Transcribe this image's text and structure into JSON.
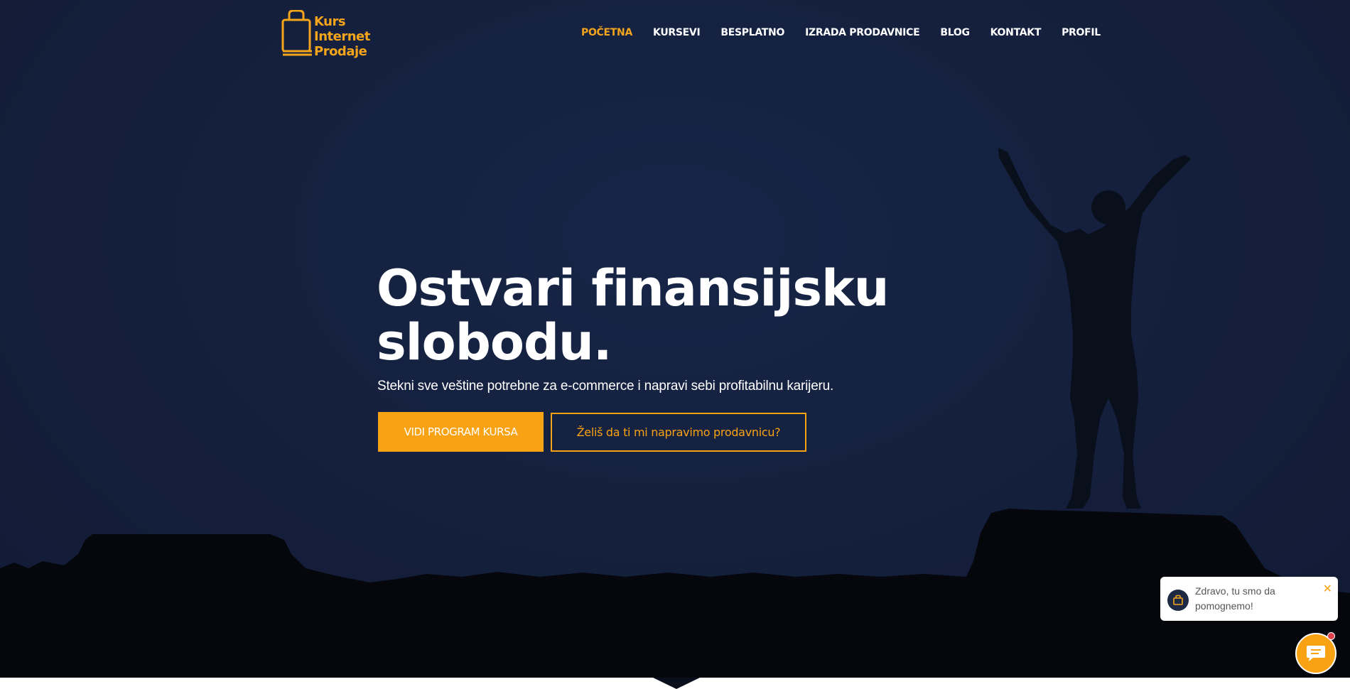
{
  "brand": {
    "logo_lines": [
      "Kurs",
      "Internet",
      "Prodaje"
    ],
    "accent_color": "#f9a314",
    "background_color": "#141f3c"
  },
  "nav": {
    "items": [
      {
        "label": "POČETNA",
        "active": true
      },
      {
        "label": "KURSEVI",
        "active": false
      },
      {
        "label": "BESPLATNO",
        "active": false
      },
      {
        "label": "IZRADA PRODAVNICE",
        "active": false
      },
      {
        "label": "BLOG",
        "active": false
      },
      {
        "label": "KONTAKT",
        "active": false
      },
      {
        "label": "PROFIL",
        "active": false
      }
    ]
  },
  "hero": {
    "headline_line1": "Ostvari finansijsku",
    "headline_line2": "slobodu.",
    "subheadline": "Stekni sve veštine potrebne za e-commerce i napravi sebi profitabilnu karijeru.",
    "primary_button": "VIDI PROGRAM KURSA",
    "secondary_button": "Želiš da ti mi napravimo prodavnicu?"
  },
  "chat": {
    "greeting": "Zdravo, tu smo da pomognemo!",
    "close_icon": "close-icon",
    "launcher_icon": "chat-icon"
  }
}
